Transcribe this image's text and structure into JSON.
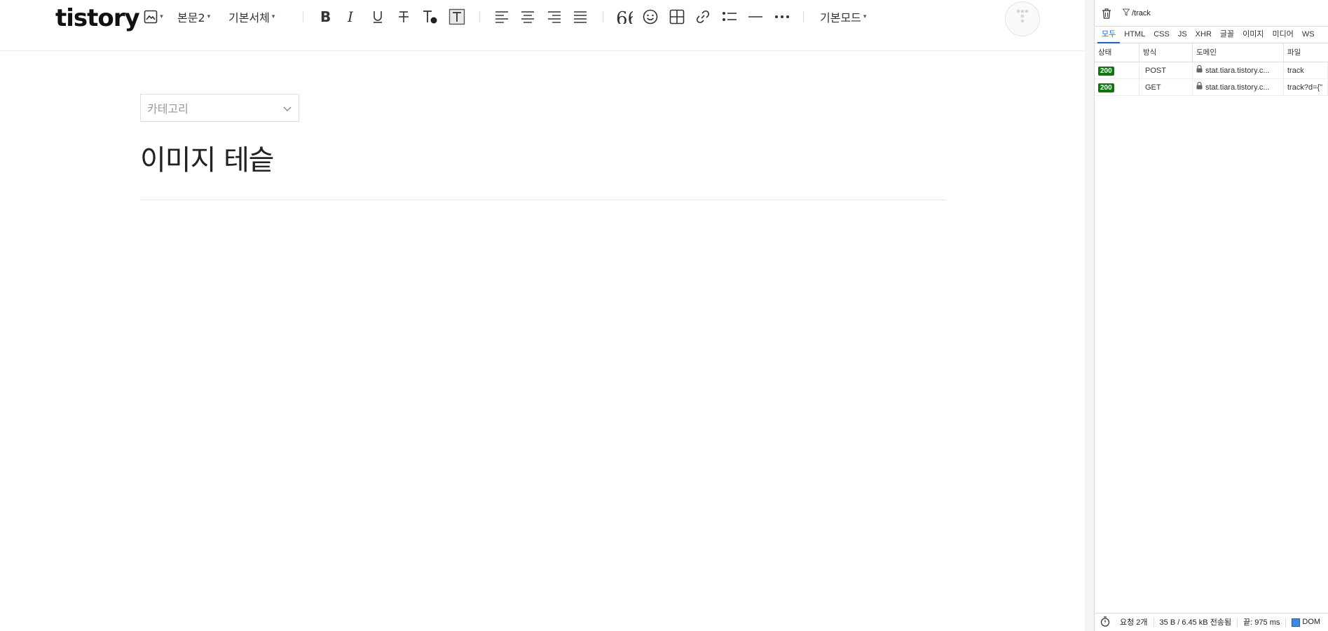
{
  "toolbar": {
    "logo": "tistory",
    "paragraph_style": "본문2",
    "font_family": "기본서체",
    "mode": "기본모드",
    "icons": [
      "image-icon",
      "bold-icon",
      "italic-icon",
      "underline-icon",
      "strikethrough-icon",
      "text-color-icon",
      "text-background-icon",
      "align-left-icon",
      "align-center-icon",
      "align-right-icon",
      "align-justify-icon",
      "quote-icon",
      "emoji-icon",
      "table-icon",
      "link-icon",
      "list-icon",
      "divider-icon",
      "more-icon"
    ]
  },
  "editor": {
    "category_placeholder": "카테고리",
    "title": "이미지 테슽"
  },
  "devtools": {
    "filter_text": "/track",
    "tabs": [
      "모두",
      "HTML",
      "CSS",
      "JS",
      "XHR",
      "글꼴",
      "이미지",
      "미디어",
      "WS"
    ],
    "active_tab": "모두",
    "columns": [
      "상태",
      "방식",
      "도메인",
      "파일"
    ],
    "requests": [
      {
        "status": "200",
        "method": "POST",
        "domain": "stat.tiara.tistory.c...",
        "file": "track"
      },
      {
        "status": "200",
        "method": "GET",
        "domain": "stat.tiara.tistory.c...",
        "file": "track?d={\""
      }
    ],
    "footer": {
      "requests": "요청 2개",
      "transfer": "35 B / 6.45 kB 전송됨",
      "finish": "끝: 975 ms",
      "dom": "DOM"
    },
    "colors": {
      "status_ok": "#0b7a0b",
      "active_tab": "#0a66d9"
    }
  }
}
